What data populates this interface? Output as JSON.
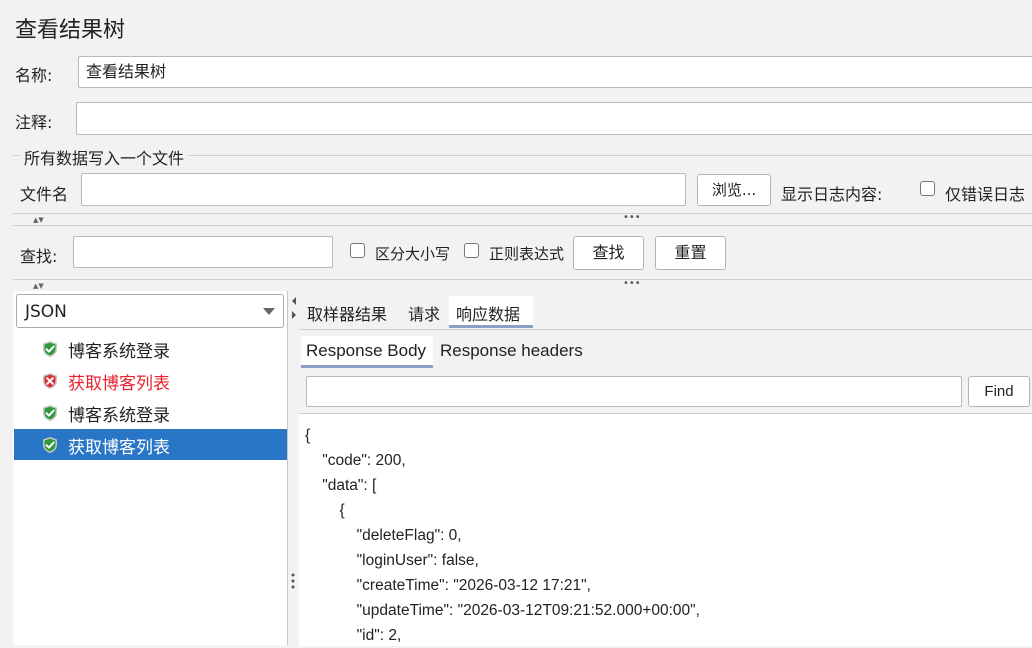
{
  "window_title": "查看结果树",
  "name_label": "名称:",
  "name_value": "查看结果树",
  "comment_label": "注释:",
  "comment_value": "",
  "file_section_title": "所有数据写入一个文件",
  "filename_label": "文件名",
  "filename_value": "",
  "browse_button": "浏览...",
  "log_content_label": "显示日志内容:",
  "errors_only_label": "仅错误日志",
  "search_label": "查找:",
  "search_value": "",
  "case_sensitive_label": "区分大小写",
  "regex_label": "正则表达式",
  "find_button": "查找",
  "reset_button": "重置",
  "renderer_select": "JSON",
  "tree_items": [
    {
      "label": "博客系统登录",
      "status": "success"
    },
    {
      "label": "获取博客列表",
      "status": "error"
    },
    {
      "label": "博客系统登录",
      "status": "success"
    },
    {
      "label": "获取博客列表",
      "status": "success",
      "selected": true
    }
  ],
  "result_tabs": [
    "取样器结果",
    "请求",
    "响应数据"
  ],
  "active_result_tab": "响应数据",
  "response_tabs": [
    "Response Body",
    "Response headers"
  ],
  "active_response_tab": "Response Body",
  "body_find_button": "Find",
  "body_find_value": "",
  "response_lines": [
    "{",
    "    \"code\": 200,",
    "    \"data\": [",
    "        {",
    "            \"deleteFlag\": 0,",
    "            \"loginUser\": false,",
    "            \"createTime\": \"2026-03-12 17:21\",",
    "            \"updateTime\": \"2026-03-12T09:21:52.000+00:00\",",
    "            \"id\": 2,"
  ],
  "colors": {
    "selection": "#2a76c6",
    "error_text": "#e8232e",
    "success_icon": "#2e9b3a",
    "error_icon": "#d93030",
    "tab_underline": "#8aa0c4"
  },
  "icons": {
    "success": "shield-check-icon",
    "error": "shield-x-icon",
    "dropdown": "chevron-down-icon",
    "splitter": "splitter-dots-icon"
  }
}
